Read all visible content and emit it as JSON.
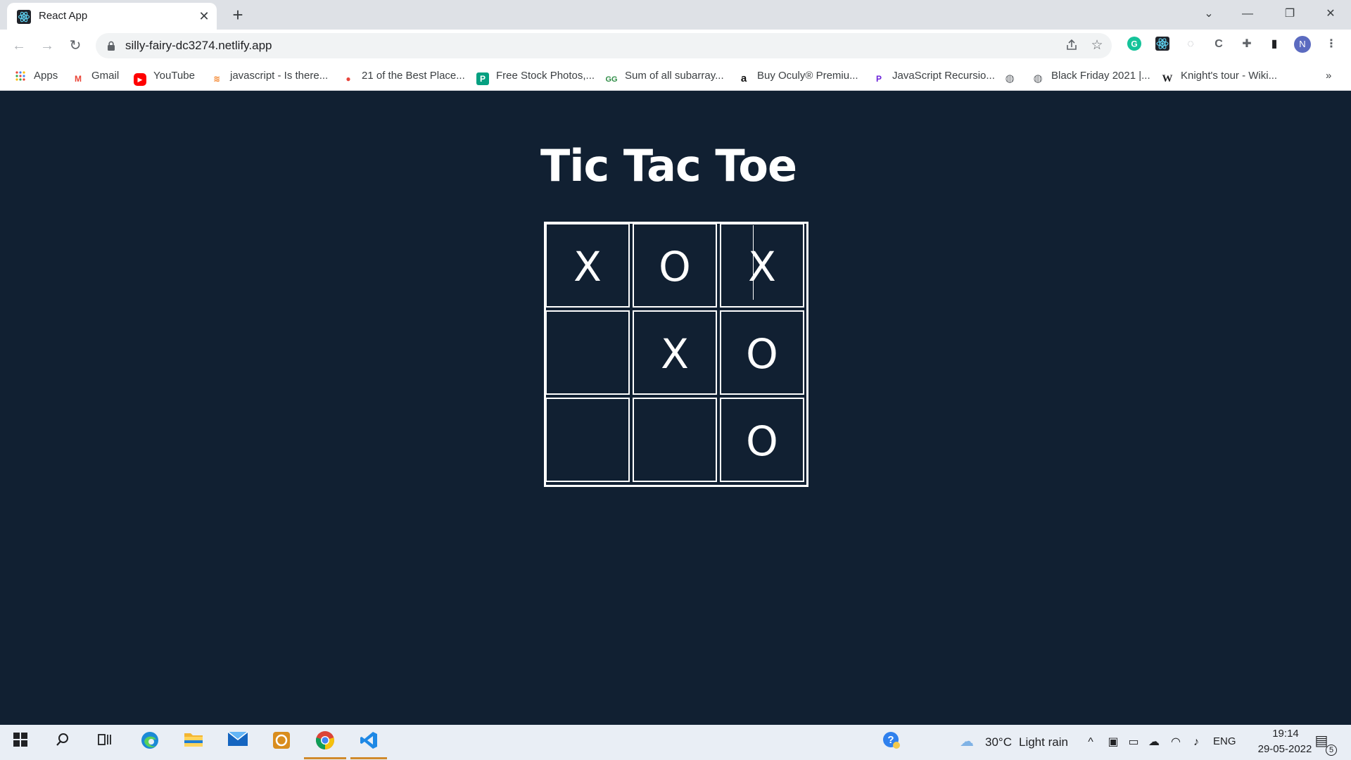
{
  "browser": {
    "tab": {
      "title": "React App",
      "close_glyph": "✕"
    },
    "new_tab_glyph": "+",
    "window_controls": {
      "tab_search": "⌄",
      "minimize": "—",
      "restore": "❐",
      "close": "✕"
    },
    "toolbar": {
      "back": "←",
      "forward": "→",
      "reload": "↻"
    },
    "address_bar": {
      "url": "silly-fairy-dc3274.netlify.app"
    },
    "profile_initial": "N",
    "bookmarks": [
      {
        "label": "Apps",
        "icon": "apps-grid-icon"
      },
      {
        "label": "Gmail",
        "icon": "gmail-icon"
      },
      {
        "label": "YouTube",
        "icon": "youtube-icon"
      },
      {
        "label": "javascript - Is there...",
        "icon": "stackoverflow-icon"
      },
      {
        "label": "21 of the Best Place...",
        "icon": "pin-icon"
      },
      {
        "label": "Free Stock Photos,...",
        "icon": "pexels-icon"
      },
      {
        "label": "Sum of all subarray...",
        "icon": "geeksforgeeks-icon"
      },
      {
        "label": "Buy Oculy® Premiu...",
        "icon": "amazon-icon"
      },
      {
        "label": "JavaScript Recursio...",
        "icon": "programiz-icon"
      },
      {
        "label": "",
        "icon": "globe-icon"
      },
      {
        "label": "Black Friday 2021 |...",
        "icon": "globe-icon"
      },
      {
        "label": "Knight's tour - Wiki...",
        "icon": "wikipedia-icon"
      }
    ],
    "bookmarks_overflow": "»"
  },
  "page": {
    "title": "Tic Tac Toe",
    "board": [
      [
        "X",
        "O",
        "X"
      ],
      [
        "",
        "X",
        "O"
      ],
      [
        "",
        "",
        "O"
      ]
    ]
  },
  "taskbar": {
    "weather": {
      "temperature": "30°C",
      "condition": "Light rain"
    },
    "language": "ENG",
    "time": "19:14",
    "date": "29-05-2022",
    "notification_count": "5"
  },
  "colors": {
    "page_background": "#112032",
    "text": "#ffffff",
    "board_lines": "#ffffff"
  }
}
